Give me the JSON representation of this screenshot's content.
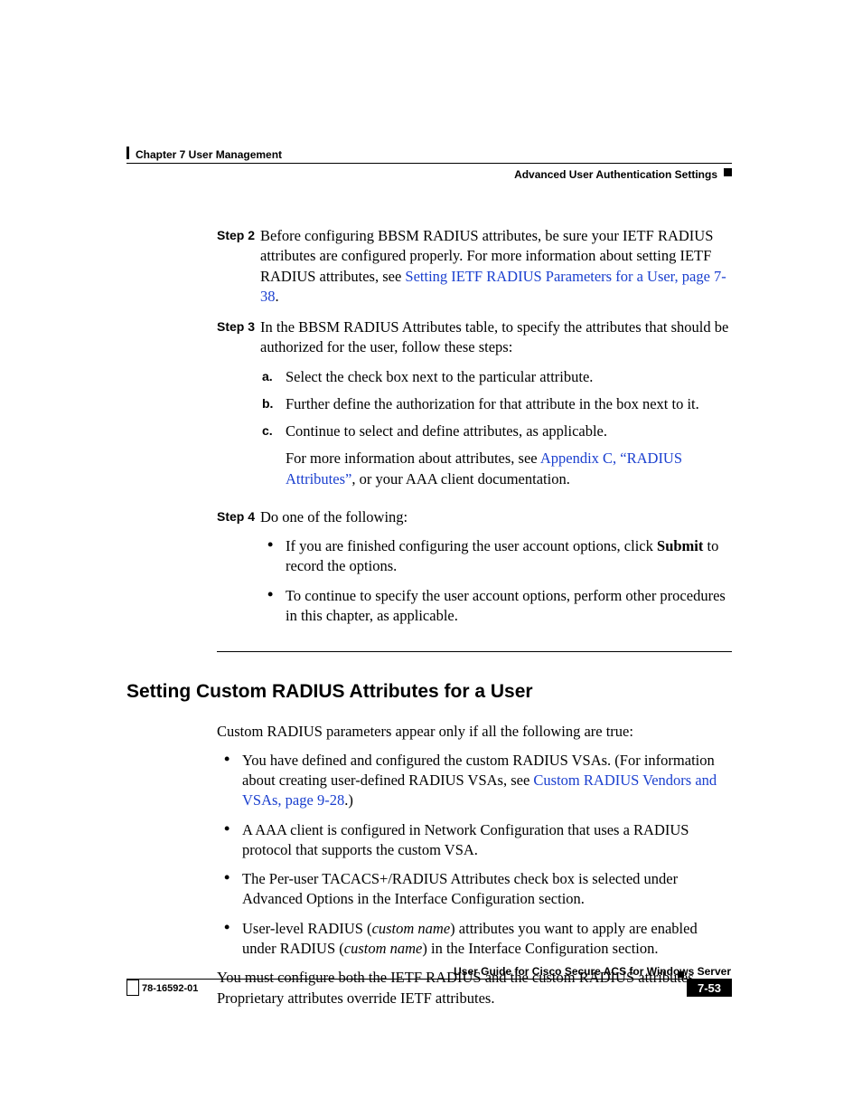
{
  "header": {
    "chapter": "Chapter 7      User Management",
    "section": "Advanced User Authentication Settings"
  },
  "steps": {
    "s2": {
      "label": "Step 2",
      "t1": "Before configuring BBSM RADIUS attributes, be sure your IETF RADIUS attributes are configured properly. For more information about setting IETF RADIUS attributes, see ",
      "link": "Setting IETF RADIUS Parameters for a User, page 7-38",
      "t2": "."
    },
    "s3": {
      "label": "Step 3",
      "intro": "In the BBSM RADIUS Attributes table, to specify the attributes that should be authorized for the user, follow these steps:",
      "a": {
        "m": "a.",
        "t": "Select the check box next to the particular attribute."
      },
      "b": {
        "m": "b.",
        "t": "Further define the authorization for that attribute in the box next to it."
      },
      "c": {
        "m": "c.",
        "t1": "Continue to select and define attributes, as applicable.",
        "t2a": "For more information about attributes, see ",
        "link": "Appendix C, “RADIUS Attributes”",
        "t2b": ", or your AAA client documentation."
      }
    },
    "s4": {
      "label": "Step 4",
      "intro": "Do one of the following:",
      "b1a": "If you are finished configuring the user account options, click ",
      "b1bold": "Submit",
      "b1b": " to record the options.",
      "b2": "To continue to specify the user account options, perform other procedures in this chapter, as applicable."
    }
  },
  "section": {
    "heading": "Setting Custom RADIUS Attributes for a User",
    "intro": "Custom RADIUS parameters appear only if all the following are true:",
    "b1a": "You have defined and configured the custom RADIUS VSAs. (For information about creating user-defined RADIUS VSAs, see ",
    "b1link": "Custom RADIUS Vendors and VSAs, page 9-28",
    "b1b": ".)",
    "b2": "A AAA client is configured in Network Configuration that uses a RADIUS protocol that supports the custom VSA.",
    "b3": "The Per-user TACACS+/RADIUS Attributes check box is selected under Advanced Options in the Interface Configuration section.",
    "b4a": "User-level RADIUS (",
    "b4i1": "custom name",
    "b4b": ") attributes you want to apply are enabled under RADIUS (",
    "b4i2": "custom name",
    "b4c": ") in the Interface Configuration section.",
    "outro": "You must configure both the IETF RADIUS and the custom RADIUS attributes. Proprietary attributes override IETF attributes."
  },
  "footer": {
    "title": "User Guide for Cisco Secure ACS for Windows Server",
    "docnum": "78-16592-01",
    "page": "7-53"
  }
}
